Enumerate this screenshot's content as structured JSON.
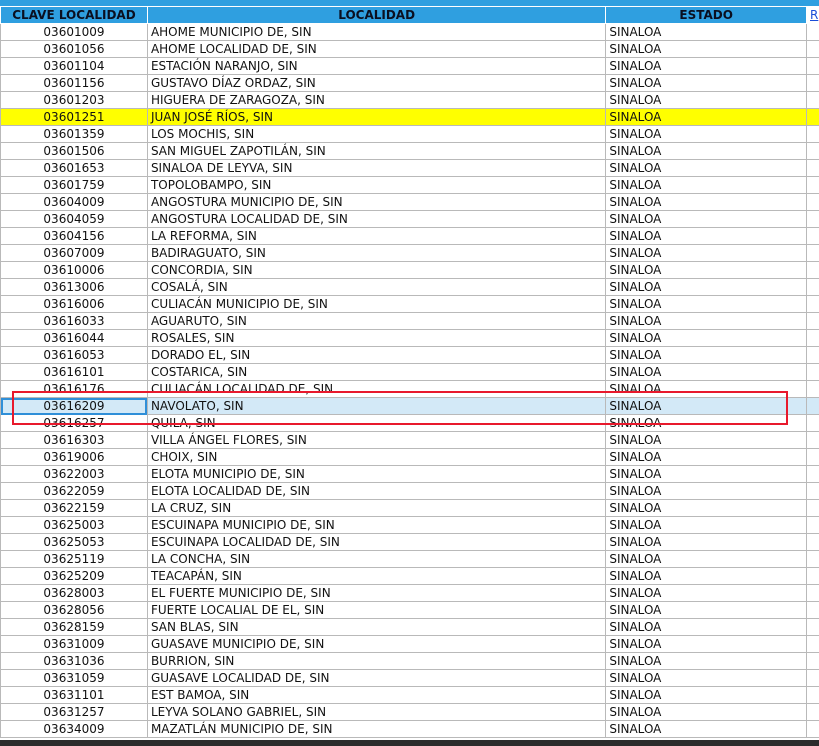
{
  "header": {
    "clave": "CLAVE LOCALIDAD",
    "localidad": "LOCALIDAD",
    "estado": "ESTADO",
    "extra": "R"
  },
  "colors": {
    "header_bg": "#2f9fe0",
    "highlight": "#ffff00",
    "selected": "#d3e9f7",
    "annotation": "#e8192c"
  },
  "rows": [
    {
      "clave": "03601009",
      "localidad": "AHOME MUNICIPIO DE, SIN",
      "estado": "SINALOA"
    },
    {
      "clave": "03601056",
      "localidad": "AHOME LOCALIDAD DE, SIN",
      "estado": "SINALOA"
    },
    {
      "clave": "03601104",
      "localidad": "ESTACIÓN NARANJO, SIN",
      "estado": "SINALOA"
    },
    {
      "clave": "03601156",
      "localidad": "GUSTAVO DÍAZ ORDAZ, SIN",
      "estado": "SINALOA"
    },
    {
      "clave": "03601203",
      "localidad": "HIGUERA DE ZARAGOZA, SIN",
      "estado": "SINALOA"
    },
    {
      "clave": "03601251",
      "localidad": "JUAN JOSÉ RÍOS, SIN",
      "estado": "SINALOA"
    },
    {
      "clave": "03601359",
      "localidad": "LOS MOCHIS, SIN",
      "estado": "SINALOA"
    },
    {
      "clave": "03601506",
      "localidad": "SAN MIGUEL ZAPOTILÁN, SIN",
      "estado": "SINALOA"
    },
    {
      "clave": "03601653",
      "localidad": "SINALOA DE LEYVA, SIN",
      "estado": "SINALOA"
    },
    {
      "clave": "03601759",
      "localidad": "TOPOLOBAMPO, SIN",
      "estado": "SINALOA"
    },
    {
      "clave": "03604009",
      "localidad": "ANGOSTURA MUNICIPIO DE, SIN",
      "estado": "SINALOA"
    },
    {
      "clave": "03604059",
      "localidad": "ANGOSTURA LOCALIDAD DE, SIN",
      "estado": "SINALOA"
    },
    {
      "clave": "03604156",
      "localidad": "LA REFORMA, SIN",
      "estado": "SINALOA"
    },
    {
      "clave": "03607009",
      "localidad": "BADIRAGUATO, SIN",
      "estado": "SINALOA"
    },
    {
      "clave": "03610006",
      "localidad": "CONCORDIA, SIN",
      "estado": "SINALOA"
    },
    {
      "clave": "03613006",
      "localidad": "COSALÁ, SIN",
      "estado": "SINALOA"
    },
    {
      "clave": "03616006",
      "localidad": "CULIACÁN MUNICIPIO DE, SIN",
      "estado": "SINALOA"
    },
    {
      "clave": "03616033",
      "localidad": "AGUARUTO, SIN",
      "estado": "SINALOA"
    },
    {
      "clave": "03616044",
      "localidad": "ROSALES, SIN",
      "estado": "SINALOA"
    },
    {
      "clave": "03616053",
      "localidad": "DORADO EL, SIN",
      "estado": "SINALOA"
    },
    {
      "clave": "03616101",
      "localidad": "COSTARICA, SIN",
      "estado": "SINALOA"
    },
    {
      "clave": "03616176",
      "localidad": "CULIACÁN LOCALIDAD DE, SIN",
      "estado": "SINALOA"
    },
    {
      "clave": "03616209",
      "localidad": "NAVOLATO, SIN",
      "estado": "SINALOA"
    },
    {
      "clave": "03616257",
      "localidad": "QUILA, SIN",
      "estado": "SINALOA"
    },
    {
      "clave": "03616303",
      "localidad": "VILLA ÁNGEL FLORES, SIN",
      "estado": "SINALOA"
    },
    {
      "clave": "03619006",
      "localidad": "CHOIX, SIN",
      "estado": "SINALOA"
    },
    {
      "clave": "03622003",
      "localidad": "ELOTA MUNICIPIO DE, SIN",
      "estado": "SINALOA"
    },
    {
      "clave": "03622059",
      "localidad": "ELOTA LOCALIDAD DE, SIN",
      "estado": "SINALOA"
    },
    {
      "clave": "03622159",
      "localidad": "LA CRUZ, SIN",
      "estado": "SINALOA"
    },
    {
      "clave": "03625003",
      "localidad": "ESCUINAPA MUNICIPIO DE, SIN",
      "estado": "SINALOA"
    },
    {
      "clave": "03625053",
      "localidad": "ESCUINAPA LOCALIDAD DE, SIN",
      "estado": "SINALOA"
    },
    {
      "clave": "03625119",
      "localidad": "LA CONCHA, SIN",
      "estado": "SINALOA"
    },
    {
      "clave": "03625209",
      "localidad": "TEACAPÁN, SIN",
      "estado": "SINALOA"
    },
    {
      "clave": "03628003",
      "localidad": "EL FUERTE MUNICIPIO DE, SIN",
      "estado": "SINALOA"
    },
    {
      "clave": "03628056",
      "localidad": "FUERTE LOCALIAL DE EL, SIN",
      "estado": "SINALOA"
    },
    {
      "clave": "03628159",
      "localidad": "SAN BLAS, SIN",
      "estado": "SINALOA"
    },
    {
      "clave": "03631009",
      "localidad": "GUASAVE MUNICIPIO DE, SIN",
      "estado": "SINALOA"
    },
    {
      "clave": "03631036",
      "localidad": "BURRION, SIN",
      "estado": "SINALOA"
    },
    {
      "clave": "03631059",
      "localidad": "GUASAVE LOCALIDAD DE, SIN",
      "estado": "SINALOA"
    },
    {
      "clave": "03631101",
      "localidad": "EST BAMOA, SIN",
      "estado": "SINALOA"
    },
    {
      "clave": "03631257",
      "localidad": "LEYVA SOLANO GABRIEL, SIN",
      "estado": "SINALOA"
    },
    {
      "clave": "03634009",
      "localidad": "MAZATLÁN MUNICIPIO DE, SIN",
      "estado": "SINALOA"
    }
  ],
  "highlighted_row": 5,
  "selected_row": 22
}
